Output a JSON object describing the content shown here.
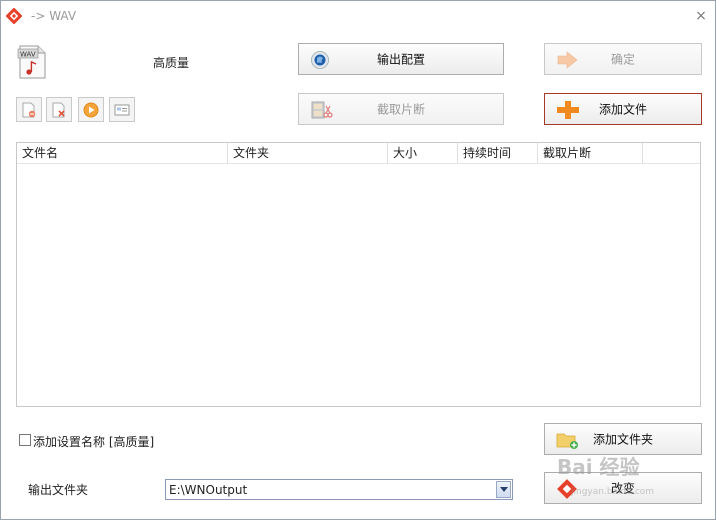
{
  "window": {
    "title": "-> WAV",
    "close_glyph": "×"
  },
  "format": {
    "icon_label": "WAV",
    "quality": "高质量"
  },
  "buttons": {
    "output_config": "输出配置",
    "confirm": "确定",
    "clip": "截取片断",
    "add_file": "添加文件",
    "add_folder": "添加文件夹",
    "change": "改变"
  },
  "toolbar": {
    "icons": [
      "remove-file-icon",
      "clear-list-icon",
      "play-icon",
      "media-info-icon"
    ]
  },
  "list": {
    "columns": [
      "文件名",
      "文件夹",
      "大小",
      "持续时间",
      "截取片断"
    ]
  },
  "options": {
    "add_setting_name": "添加设置名称 [高质量]",
    "checked": false
  },
  "output": {
    "label": "输出文件夹",
    "path": "E:\\WNOutput"
  },
  "watermark": {
    "brand": "Bai 经验",
    "url": "jingyan.baidu.com"
  },
  "colors": {
    "accent": "#e8402a",
    "primary_border": "#a33a2a",
    "disabled_text": "#9b9b9b"
  }
}
